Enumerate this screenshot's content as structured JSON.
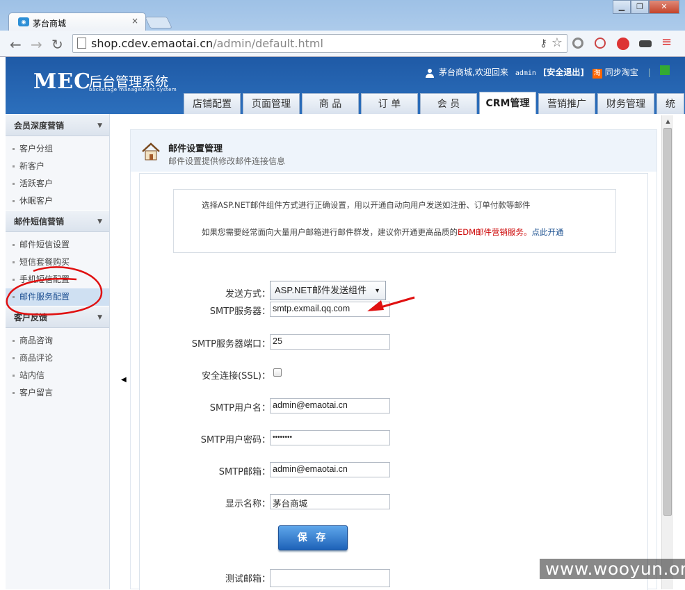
{
  "browser": {
    "tab_title": "茅台商城",
    "tab_close": "×",
    "url_host": "shop.cdev.emaotai.cn",
    "url_path": "/admin/default.html",
    "window_buttons": [
      "▁",
      "❐",
      "✕"
    ]
  },
  "header": {
    "logo_main": "MEC",
    "logo_sys": "后台管理系统",
    "logo_sub": "backstage management system",
    "welcome": "茅台商城,欢迎回来",
    "username": "admin",
    "logout": "[安全退出]",
    "taobao_icon": "淘",
    "sync_taobao": "同步淘宝",
    "separator": "|"
  },
  "nav_tabs": [
    {
      "label": "店铺配置"
    },
    {
      "label": "页面管理"
    },
    {
      "label": "商 品"
    },
    {
      "label": "订 单"
    },
    {
      "label": "会 员"
    },
    {
      "label": "CRM管理"
    },
    {
      "label": "营销推广"
    },
    {
      "label": "财务管理"
    },
    {
      "label": "统计"
    }
  ],
  "active_tab": "CRM管理",
  "sidebar": {
    "groups": [
      {
        "title": "会员深度营销",
        "items": [
          "客户分组",
          "新客户",
          "活跃客户",
          "休眠客户"
        ]
      },
      {
        "title": "邮件短信营销",
        "items": [
          "邮件短信设置",
          "短信套餐购买",
          "手机短信配置",
          "邮件服务配置"
        ]
      },
      {
        "title": "客户反馈",
        "items": [
          "商品咨询",
          "商品评论",
          "站内信",
          "客户留言"
        ]
      }
    ],
    "active_item": "邮件服务配置"
  },
  "page": {
    "title": "邮件设置管理",
    "subtitle": "邮件设置提供修改邮件连接信息",
    "notice_line1": "选择ASP.NET邮件组件方式进行正确设置，用以开通自动向用户发送如注册、订单付款等邮件",
    "notice_line2_prefix": "如果您需要经常面向大量用户邮箱进行邮件群发，建议你开通更高品质的",
    "notice_line2_red": "EDM邮件营销服务。",
    "notice_line2_link": "点此开通"
  },
  "form": {
    "send_method_label": "发送方式：",
    "send_method_value": "ASP.NET邮件发送组件",
    "smtp_server_label": "SMTP服务器：",
    "smtp_server_value": "smtp.exmail.qq.com",
    "smtp_port_label": "SMTP服务器端口：",
    "smtp_port_value": "25",
    "ssl_label": "安全连接(SSL)：",
    "ssl_checked": false,
    "smtp_user_label": "SMTP用户名：",
    "smtp_user_value": "admin@emaotai.cn",
    "smtp_pass_label": "SMTP用户密码：",
    "smtp_pass_value": "••••••••",
    "smtp_email_label": "SMTP邮箱：",
    "smtp_email_value": "admin@emaotai.cn",
    "display_name_label": "显示名称：",
    "display_name_value": "茅台商城",
    "save_label": "保 存",
    "test_email_label": "测试邮箱：",
    "test_email_value": ""
  },
  "watermark": "www.wooyun.org",
  "colors": {
    "header_blue": "#2c6fbc",
    "annotation_red": "#e01010",
    "link_blue": "#1a4f8f",
    "save_button": "#1e62b8"
  }
}
